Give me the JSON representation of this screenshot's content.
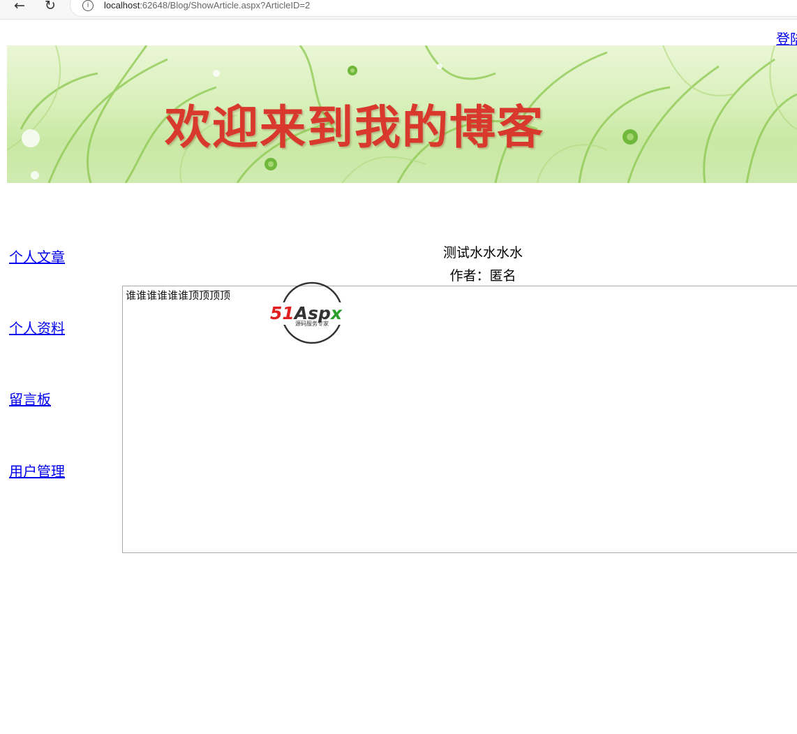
{
  "browser": {
    "url_host": "localhost",
    "url_rest": ":62648/Blog/ShowArticle.aspx?ArticleID=2"
  },
  "header": {
    "login_label": "登陆",
    "banner_title": "欢迎来到我的博客"
  },
  "menu": {
    "items": [
      {
        "label": "个人文章"
      },
      {
        "label": "个人资料"
      },
      {
        "label": "留言板"
      },
      {
        "label": "用户管理"
      }
    ]
  },
  "article": {
    "title": "测试水水水水",
    "author": "作者：匿名",
    "content": "谁谁谁谁谁谁顶顶顶顶"
  },
  "watermark": {
    "brand": "51Aspx",
    "brand_red": "51",
    "brand_dark": "Asp",
    "brand_green": "x",
    "tagline": "源码服务专家"
  },
  "colors": {
    "link": "#0000ee",
    "banner_title": "#d9382c",
    "banner_bg": "#d7efb8"
  }
}
